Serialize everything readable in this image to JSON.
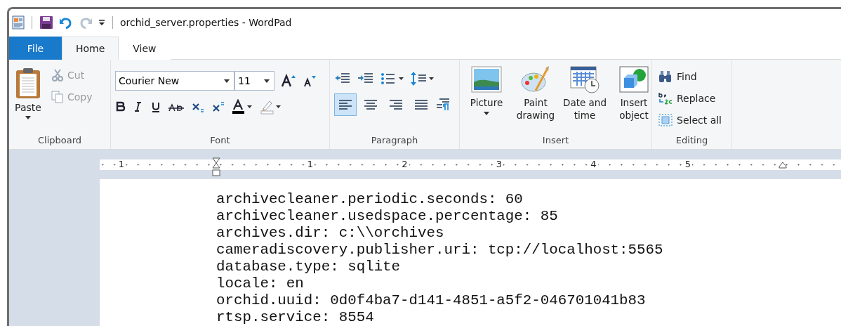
{
  "window": {
    "title": "orchid_server.properties - WordPad"
  },
  "tabs": [
    {
      "label": "File",
      "kind": "file",
      "selected": false
    },
    {
      "label": "Home",
      "kind": "tab",
      "selected": true
    },
    {
      "label": "View",
      "kind": "tab",
      "selected": false
    }
  ],
  "clipboard": {
    "label": "Clipboard",
    "paste": "Paste",
    "items": [
      {
        "label": "Cut",
        "kind": "cut",
        "disabled": true
      },
      {
        "label": "Copy",
        "kind": "copy",
        "disabled": true
      }
    ]
  },
  "font": {
    "label": "Font",
    "font_name": "Courier New",
    "font_size": "11"
  },
  "paragraph": {
    "label": "Paragraph",
    "alignments": [
      {
        "kind": "left",
        "selected": true
      },
      {
        "kind": "center",
        "selected": false
      },
      {
        "kind": "right",
        "selected": false
      },
      {
        "kind": "justify",
        "selected": false
      }
    ]
  },
  "insert": {
    "label": "Insert",
    "buttons": [
      {
        "label": "Picture",
        "kind": "picture"
      },
      {
        "label": "Paint drawing",
        "kind": "paint"
      },
      {
        "label": "Date and time",
        "kind": "datetime"
      },
      {
        "label": "Insert object",
        "kind": "object"
      }
    ]
  },
  "editing": {
    "label": "Editing",
    "items": [
      {
        "label": "Find",
        "kind": "find"
      },
      {
        "label": "Replace",
        "kind": "replace"
      },
      {
        "label": "Select all",
        "kind": "selectall"
      }
    ]
  },
  "ruler": {
    "labels": [
      "1",
      "1",
      "2",
      "3",
      "4",
      "5"
    ]
  },
  "document": {
    "lines": [
      "archivecleaner.periodic.seconds: 60",
      "archivecleaner.usedspace.percentage: 85",
      "archives.dir: c:\\\\orchives",
      "cameradiscovery.publisher.uri: tcp://localhost:5565",
      "database.type: sqlite",
      "locale: en",
      "orchid.uuid: 0d0f4ba7-d141-4851-a5f2-046701041b83",
      "rtsp.service: 8554"
    ]
  }
}
